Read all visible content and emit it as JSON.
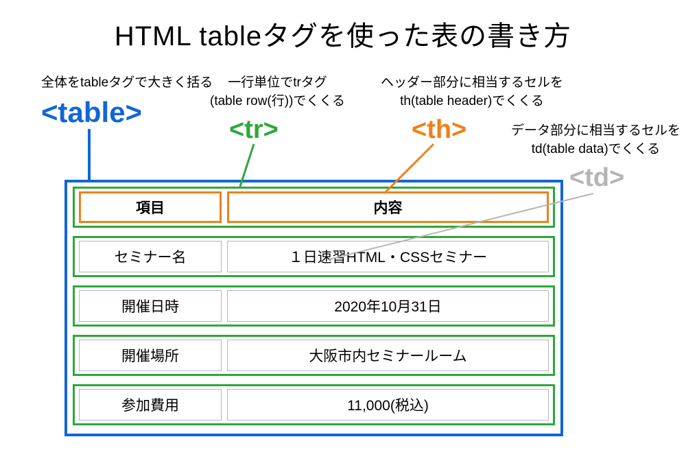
{
  "title": "HTML tableタグを使った表の書き方",
  "annotations": {
    "table": "全体をtableタグで大きく括る",
    "tr_line1": "一行単位でtrタグ",
    "tr_line2": "(table row(行))でくくる",
    "th_line1": "ヘッダー部分に相当するセルを",
    "th_line2": "th(table header)でくくる",
    "td_line1": "データ部分に相当するセルを",
    "td_line2": "td(table data)でくくる"
  },
  "tags": {
    "table": "<table>",
    "tr": "<tr>",
    "th": "<th>",
    "td": "<td>"
  },
  "headers": {
    "col1": "項目",
    "col2": "内容"
  },
  "rows": [
    {
      "col1": "セミナー名",
      "col2": "１日速習HTML・CSSセミナー"
    },
    {
      "col1": "開催日時",
      "col2": "2020年10月31日"
    },
    {
      "col1": "開催場所",
      "col2": "大阪市内セミナールーム"
    },
    {
      "col1": "参加費用",
      "col2": "11,000(税込)"
    }
  ],
  "colors": {
    "table": "#1266d6",
    "tr": "#2da83a",
    "th": "#f08019",
    "td": "#b5b5b5"
  }
}
